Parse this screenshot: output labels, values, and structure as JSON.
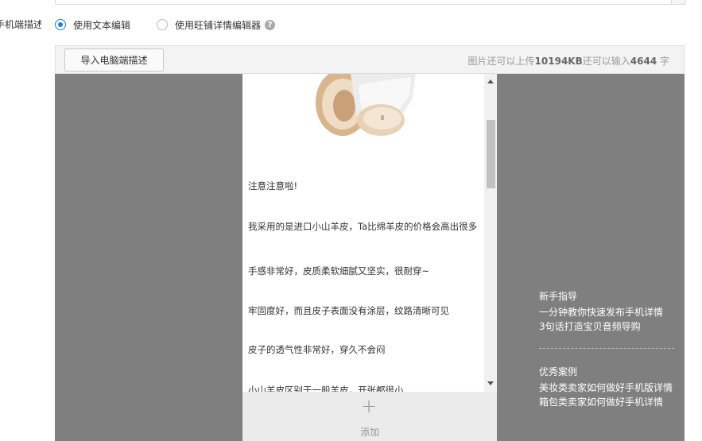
{
  "row_label": "手机端描述",
  "radio_options": [
    {
      "label": "使用文本编辑",
      "checked": true
    },
    {
      "label": "使用旺铺详情编辑器",
      "checked": false
    }
  ],
  "help_icon_glyph": "?",
  "toolbar": {
    "import_button": "导入电脑端描述",
    "quota_prefix": "图片还可以上传",
    "quota_image_kb": "10194KB",
    "quota_mid": "还可以输入",
    "quota_chars": "4644",
    "quota_suffix": " 字"
  },
  "phone": {
    "paragraphs": [
      "注意注意啦!",
      "我采用的是进口小山羊皮，Ta比绵羊皮的价格会高出很多",
      "手感非常好，皮质柔软细腻又坚实，很耐穿~",
      "牢固度好，而且皮子表面没有涂层，纹路清晰可见",
      "皮子的透气性非常好，穿久不会闷",
      "小山羊皮区别于一般羊皮，开张都很小"
    ]
  },
  "add_block": {
    "plus": "+",
    "label": "添加"
  },
  "side_panel": {
    "guide_title": "新手指导",
    "guide_links": [
      "一分钟教你快速发布手机详情",
      "3句话打造宝贝音频导购"
    ],
    "cases_title": "优秀案例",
    "cases_links": [
      "美妆类卖家如何做好手机版详情",
      "箱包类卖家如何做好手机详情"
    ]
  },
  "colors": {
    "canvas_bg": "#7f7f7f",
    "radio_accent": "#1f7de6"
  },
  "icons": [
    "help-icon",
    "plus-icon",
    "scroll-up-icon",
    "scroll-down-icon"
  ]
}
